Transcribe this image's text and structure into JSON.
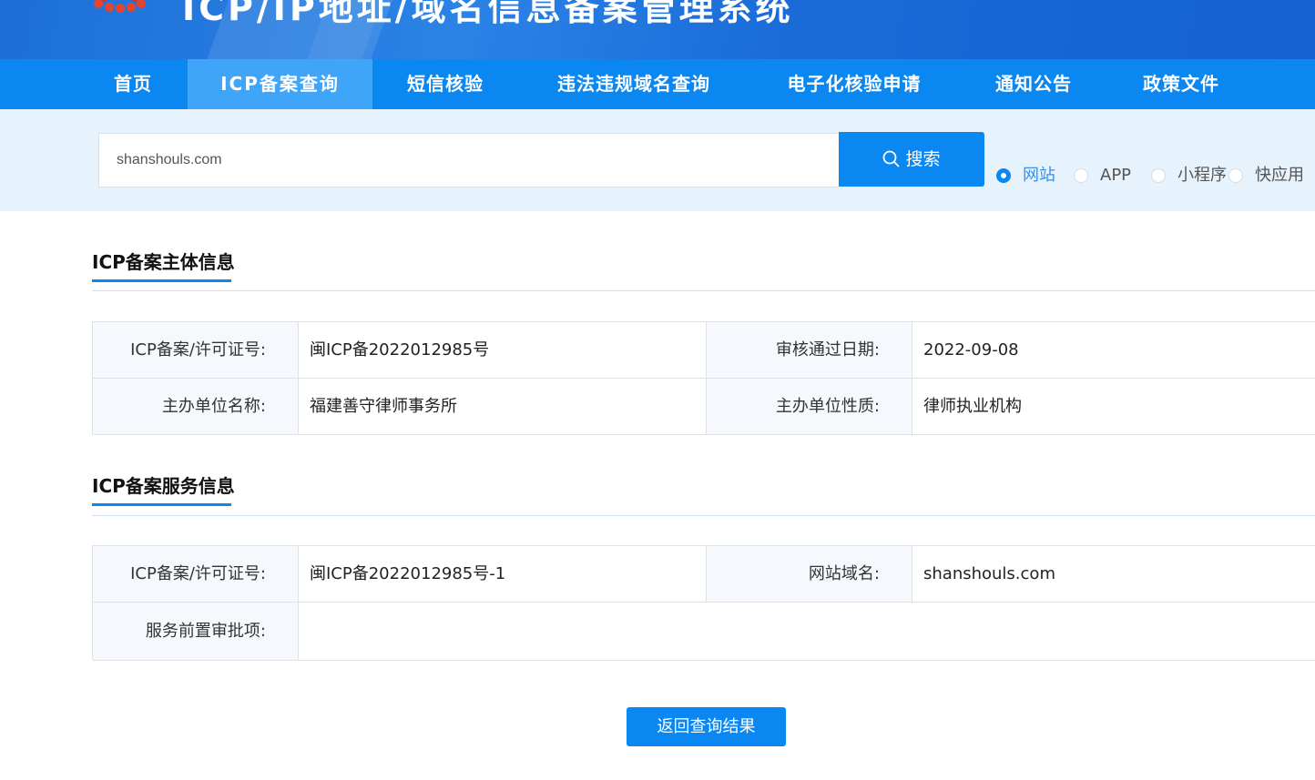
{
  "banner": {
    "title": "ICP/IP地址/域名信息备案管理系统"
  },
  "nav": {
    "items": [
      {
        "label": "首页"
      },
      {
        "label": "ICP备案查询"
      },
      {
        "label": "短信核验"
      },
      {
        "label": "违法违规域名查询"
      },
      {
        "label": "电子化核验申请"
      },
      {
        "label": "通知公告"
      },
      {
        "label": "政策文件"
      }
    ],
    "active": "ICP备案查询"
  },
  "search": {
    "value": "shanshouls.com",
    "button_label": "搜索",
    "types": [
      {
        "label": "网站",
        "checked": true
      },
      {
        "label": "APP",
        "checked": false
      },
      {
        "label": "小程序",
        "checked": false
      },
      {
        "label": "快应用",
        "checked": false
      }
    ]
  },
  "subject_info": {
    "title": "ICP备案主体信息",
    "rows": [
      {
        "k1": "ICP备案/许可证号:",
        "v1": "闽ICP备2022012985号",
        "k2": "审核通过日期:",
        "v2": "2022-09-08"
      },
      {
        "k1": "主办单位名称:",
        "v1": "福建善守律师事务所",
        "k2": "主办单位性质:",
        "v2": "律师执业机构"
      }
    ]
  },
  "service_info": {
    "title": "ICP备案服务信息",
    "rows": [
      {
        "k1": "ICP备案/许可证号:",
        "v1": "闽ICP备2022012985号-1",
        "k2": "网站域名:",
        "v2": "shanshouls.com"
      },
      {
        "k1": "服务前置审批项:",
        "v1": ""
      }
    ]
  },
  "back_button_label": "返回查询结果",
  "colors": {
    "primary": "#0a87f0",
    "nav_active": "#3fa5f8",
    "search_band": "#e6f2fc"
  }
}
